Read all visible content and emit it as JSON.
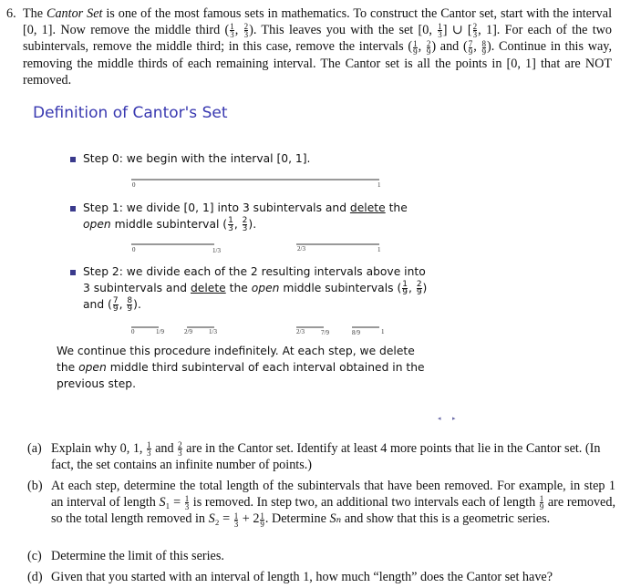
{
  "question": {
    "number": "6.",
    "text": [
      "The ",
      {
        "i": "Cantor Set"
      },
      " is one of the most famous sets in mathematics. To construct the Cantor set, start with the interval [0, 1]. Now remove the middle third (",
      {
        "f": [
          "1",
          "3"
        ]
      },
      ", ",
      {
        "f": [
          "2",
          "3"
        ]
      },
      "). This leaves you with the set [0, ",
      {
        "f": [
          "1",
          "3"
        ]
      },
      "] ∪ [",
      {
        "f": [
          "2",
          "3"
        ]
      },
      ", 1]. For each of the two subintervals, remove the middle third; in this case, remove the intervals (",
      {
        "f": [
          "1",
          "9"
        ]
      },
      ", ",
      {
        "f": [
          "2",
          "9"
        ]
      },
      ") and (",
      {
        "f": [
          "7",
          "9"
        ]
      },
      ", ",
      {
        "f": [
          "8",
          "9"
        ]
      },
      "). Continue in this way, removing the middle thirds of each remaining interval. The Cantor set is all the points in [0, 1] that are NOT removed."
    ]
  },
  "slide": {
    "title": "Definition of Cantor's Set",
    "steps": [
      {
        "text": [
          "Step 0:  we begin with the interval [0, 1]."
        ]
      },
      {
        "text": [
          "Step 1:  we divide [0, 1] into 3 subintervals and ",
          {
            "u": "delete"
          },
          " the ",
          {
            "i": "open"
          },
          " middle subinterval (",
          {
            "f": [
              "1",
              "3"
            ]
          },
          ", ",
          {
            "f": [
              "2",
              "3"
            ]
          },
          ")."
        ]
      },
      {
        "text": [
          "Step 2:  we divide each of the 2 resulting intervals above into 3 subintervals and ",
          {
            "u": "delete"
          },
          " the ",
          {
            "i": "open"
          },
          " middle subintervals (",
          {
            "f": [
              "1",
              "9"
            ]
          },
          ", ",
          {
            "f": [
              "2",
              "9"
            ]
          },
          ") and (",
          {
            "f": [
              "7",
              "9"
            ]
          },
          ", ",
          {
            "f": [
              "8",
              "9"
            ]
          },
          ")."
        ]
      }
    ],
    "tick_labels": {
      "step0": [
        "0",
        "1"
      ],
      "step1": [
        "0",
        "1/3",
        "2/3",
        "1"
      ],
      "step2": [
        "0",
        "1/9",
        "2/9",
        "1/3",
        "2/3",
        "7/9",
        "8/9",
        "1"
      ]
    },
    "conclusion": [
      "We continue this procedure indefinitely.  At each step, we delete the ",
      {
        "i": "open"
      },
      " middle third subinterval of each interval obtained in the previous step."
    ],
    "nav_icons": [
      "arrow-left-icon",
      "arrow-right-icon"
    ]
  },
  "parts": [
    {
      "label": "(a)",
      "text": [
        "Explain why 0, 1, ",
        {
          "f": [
            "1",
            "3"
          ]
        },
        " and ",
        {
          "f": [
            "2",
            "3"
          ]
        },
        " are in the Cantor set. Identify at least 4 more points that lie in the Cantor set. (In fact, the set contains an infinite number of points.)"
      ]
    },
    {
      "label": "(b)",
      "text": [
        "At each step, determine the total length of the subintervals that have been removed. For example, in step 1 an interval of length ",
        {
          "i": "S"
        },
        "₁ = ",
        {
          "f": [
            "1",
            "3"
          ]
        },
        " is removed. In step two, an additional two intervals each of length ",
        {
          "f": [
            "1",
            "9"
          ]
        },
        " are removed, so the total length removed in ",
        {
          "i": "S"
        },
        "₂ = ",
        {
          "f": [
            "1",
            "3"
          ]
        },
        " + 2",
        {
          "f": [
            "1",
            "9"
          ]
        },
        ". Determine ",
        {
          "i": "Sₙ"
        },
        " and show that this is a geometric series."
      ]
    },
    {
      "label": "(c)",
      "text": [
        "Determine the limit of this series."
      ]
    },
    {
      "label": "(d)",
      "text": [
        "Given that you started with an interval of length 1, how much “length” does the Cantor set have?"
      ]
    }
  ]
}
